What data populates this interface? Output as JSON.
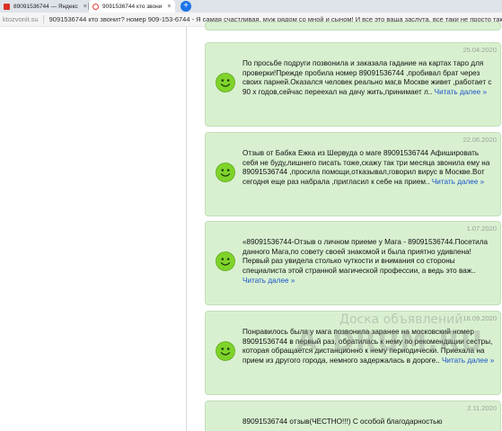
{
  "browser": {
    "tabs": [
      {
        "title": "89091536744 — Яндекс"
      },
      {
        "title": "9091536744 кто звони"
      }
    ],
    "new_tab_label": "+",
    "close_label": "×"
  },
  "site": {
    "domain": "ktozvonit.su",
    "title": "9091536744 кто звонит? номер 909-153-6744 - Я самая счастливая, муж рядом со мной и сыном! И все это ваша заслута, все таки не просто так, не каждый"
  },
  "reviews": [
    {
      "date": "25.04.2020",
      "text": "По просьбе подруги позвонила и заказала гадание на картах таро для проверки!Прежде пробила номер 89091536744 ,пробивал брат через своих парней.Оказался человек реально маг,в Москве живет ,работает с 90 х годов,сейчас переехал на дачу жить,принимает л..",
      "read_more": "Читать далее »"
    },
    {
      "date": "22.06.2020",
      "text": "Отзыв от Бабка Ежка из Шервуда о маге 89091536744 Афишировать себя не буду,лишнего писать тоже,скажу так три месяца звонила ему на 89091536744 ,просила помощи,отказывал,говорил вирус в Москве.Вот сегодня еще раз набрала ,пригласил к себе на прием..",
      "read_more": "Читать далее »"
    },
    {
      "date": "1.07.2020",
      "text": "«89091536744-Отзыв о личном приеме у Мага - 89091536744.Посетила данного Мага,по совету своей знакомой и была приятно удивлена! Первый раз увидела столько чуткости и внимания со стороны специалиста этой странной магической профессии, а ведь это важ..",
      "read_more": "Читать далее »"
    },
    {
      "date": "16.09.2020",
      "text": "Понравилось была у мага позвонила заранее на московский номер 89091536744 в первый раз, обратилась к нему по рекомендации сестры, которая обращается дистанционно к нему периодически. Приехала на прием из другого города, немного задержалась в дороге..",
      "read_more": "Читать далее »"
    },
    {
      "date": "2.11.2020",
      "text": "89091536744 отзыв(ЧЕСТНО!!!) С особой благодарностью",
      "read_more": ""
    }
  ],
  "watermark": {
    "line1": "Доска объявлений",
    "line2": "DRUM.RU",
    "letter": "A"
  },
  "colors": {
    "card_bg": "#d8f0d0",
    "link": "#1a55c8",
    "smiley": "#7fd32a"
  }
}
